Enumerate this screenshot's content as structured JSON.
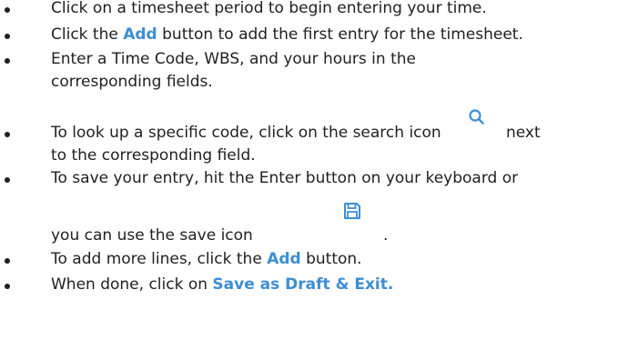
{
  "instructions": {
    "item1": {
      "text": "Click on a timesheet period to begin entering your time."
    },
    "item2": {
      "pre": "Click the ",
      "link": "Add",
      "post": " button to add the first entry for the timesheet."
    },
    "item3": {
      "line1": "Enter a Time Code, WBS, and your hours in the",
      "line2": "corresponding fields."
    },
    "item4": {
      "line1_pre": "To look up a specific code, click on the search icon",
      "line1_post": "next",
      "line2": "to the corresponding field.",
      "icon": "search-icon"
    },
    "item5": {
      "line1": "To save your entry, hit the Enter button on your keyboard or",
      "line2_pre": "you can use the save icon",
      "line2_post": ".",
      "icon": "save-icon"
    },
    "item6": {
      "pre": "To add more lines, click the ",
      "link": "Add",
      "post": " button."
    },
    "item7": {
      "pre": "When done, click on ",
      "link": "Save as Draft & Exit."
    }
  },
  "colors": {
    "accent": "#3c8ed3",
    "text": "#1f1f1f"
  }
}
